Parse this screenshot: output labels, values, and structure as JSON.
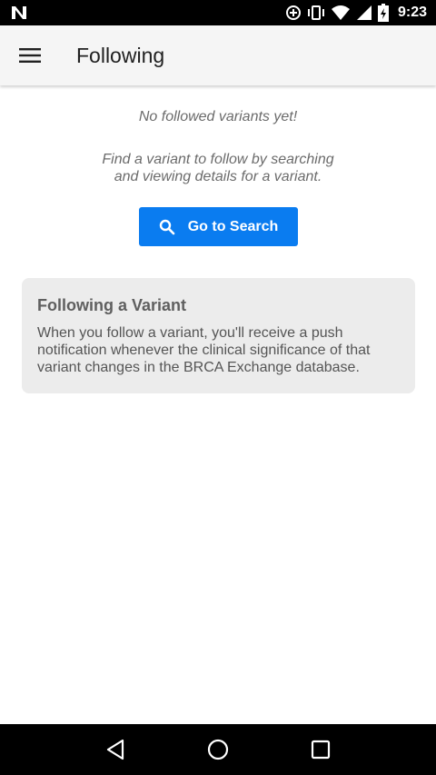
{
  "status_bar": {
    "time": "9:23",
    "icons": [
      "n-logo-icon",
      "data-saver-icon",
      "vibrate-icon",
      "wifi-icon",
      "signal-icon",
      "battery-charging-icon"
    ]
  },
  "app_bar": {
    "menu_icon": "hamburger-menu-icon",
    "title": "Following"
  },
  "main": {
    "empty_message": "No followed variants yet!",
    "hint_line1": "Find a variant to follow by searching",
    "hint_line2": "and viewing details for a variant.",
    "search_button": {
      "icon": "search-icon",
      "label": "Go to Search",
      "color": "#0a7cf0"
    },
    "info_card": {
      "title": "Following a Variant",
      "body": "When you follow a variant, you'll receive a push notification whenever the clinical significance of that variant changes in the BRCA Exchange database."
    }
  },
  "nav_bar": {
    "back_icon": "back-triangle-icon",
    "home_icon": "home-circle-icon",
    "recents_icon": "recents-square-icon"
  }
}
